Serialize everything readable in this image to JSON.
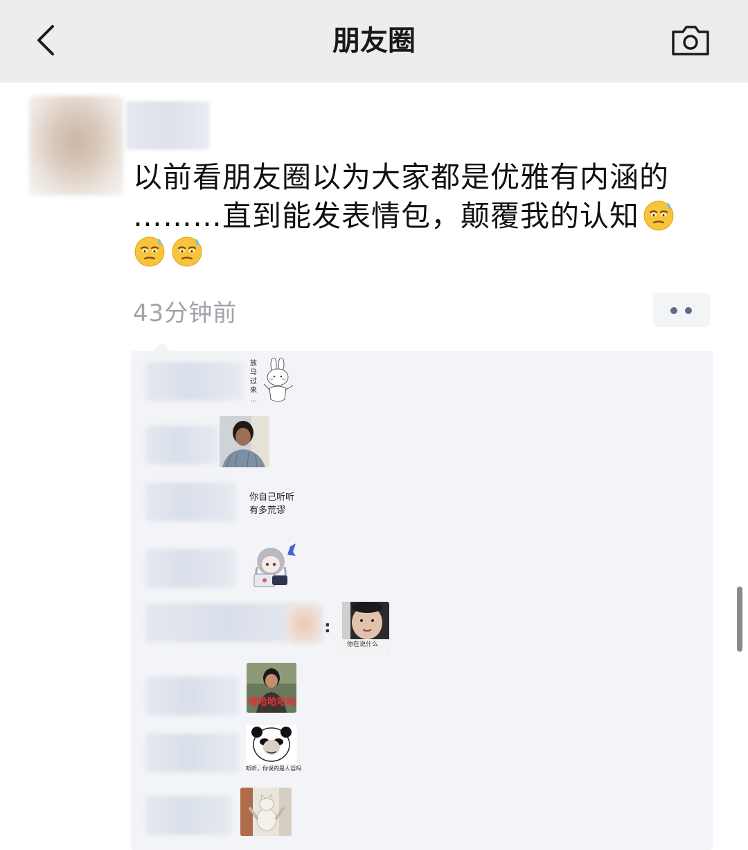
{
  "header": {
    "title": "朋友圈",
    "back_icon": "chevron-left-icon",
    "camera_icon": "camera-icon"
  },
  "post": {
    "text_line1": "以前看朋友圈以为大家都是优雅有内涵的",
    "text_line2": "………直到能发表情包，颠覆我的认知",
    "emoji_name": "sweat-smile-emoji-icon",
    "emoji_count": 3,
    "timestamp": "43分钟前"
  },
  "comments": {
    "sticker1_text": "放\n马\n过\n来\n…",
    "sticker3_text": "你自己听听\n有多荒谬",
    "sticker5_caption": "你在说什么",
    "sticker6_caption": "哦哈哈哈哈",
    "sticker7_caption": "听听，你说的是人话吗",
    "colon": ":"
  },
  "colors": {
    "header_bg": "#ededed",
    "comment_bg": "#f3f4f7",
    "more_dots": "#5c6b8a",
    "timestamp": "#9fa3aa",
    "sticker6_caption_color": "#e0303a"
  }
}
